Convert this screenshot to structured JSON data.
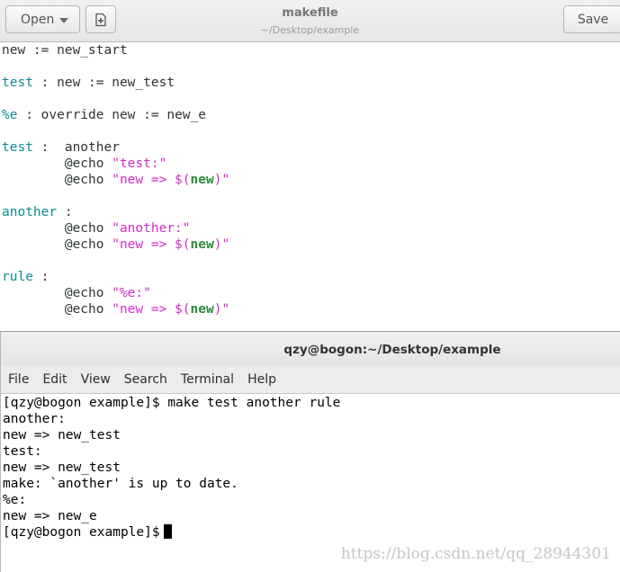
{
  "gedit": {
    "open_label": "Open",
    "save_label": "Save",
    "title": "makefile",
    "path": "~/Desktop/example",
    "icons": {
      "open_dropdown": "chevron-down-icon",
      "new_document": "new-document-icon"
    }
  },
  "editor": {
    "lines": [
      [
        {
          "t": "new := new_start",
          "c": ""
        }
      ],
      [],
      [
        {
          "t": "test",
          "c": "teal"
        },
        {
          "t": " : new := new_test",
          "c": ""
        }
      ],
      [],
      [
        {
          "t": "%e",
          "c": "teal"
        },
        {
          "t": " : override new := new_e",
          "c": ""
        }
      ],
      [],
      [
        {
          "t": "test",
          "c": "teal"
        },
        {
          "t": " :  another",
          "c": ""
        }
      ],
      [
        {
          "t": "        @echo ",
          "c": ""
        },
        {
          "t": "\"test:\"",
          "c": "str"
        }
      ],
      [
        {
          "t": "        @echo ",
          "c": ""
        },
        {
          "t": "\"new => $(",
          "c": "str"
        },
        {
          "t": "new",
          "c": "var"
        },
        {
          "t": ")\"",
          "c": "str"
        }
      ],
      [],
      [
        {
          "t": "another",
          "c": "teal"
        },
        {
          "t": " :",
          "c": ""
        }
      ],
      [
        {
          "t": "        @echo ",
          "c": ""
        },
        {
          "t": "\"another:\"",
          "c": "str"
        }
      ],
      [
        {
          "t": "        @echo ",
          "c": ""
        },
        {
          "t": "\"new => $(",
          "c": "str"
        },
        {
          "t": "new",
          "c": "var"
        },
        {
          "t": ")\"",
          "c": "str"
        }
      ],
      [],
      [
        {
          "t": "rule",
          "c": "teal"
        },
        {
          "t": " :",
          "c": ""
        }
      ],
      [
        {
          "t": "        @echo ",
          "c": ""
        },
        {
          "t": "\"%e:\"",
          "c": "str"
        }
      ],
      [
        {
          "t": "        @echo ",
          "c": ""
        },
        {
          "t": "\"new => $(",
          "c": "str"
        },
        {
          "t": "new",
          "c": "var"
        },
        {
          "t": ")\"",
          "c": "str"
        }
      ]
    ]
  },
  "terminal": {
    "title": "qzy@bogon:~/Desktop/example",
    "menu": [
      "File",
      "Edit",
      "View",
      "Search",
      "Terminal",
      "Help"
    ],
    "output": [
      "[qzy@bogon example]$ make test another rule",
      "another:",
      "new => new_test",
      "test:",
      "new => new_test",
      "make: `another' is up to date.",
      "%e:",
      "new => new_e"
    ],
    "prompt": "[qzy@bogon example]$"
  },
  "watermark": "https://blog.csdn.net/qq_28944301"
}
